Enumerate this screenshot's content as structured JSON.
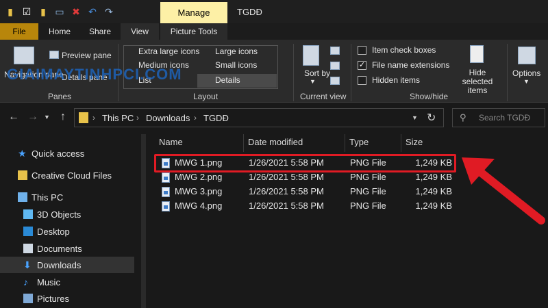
{
  "titlebar": {
    "manage_tab": "Manage",
    "window_title": "TGDĐ",
    "qat_icons": [
      "folder-icon",
      "checklist-icon",
      "folder-icon",
      "rename-icon",
      "delete-icon",
      "undo-icon",
      "redo-icon"
    ]
  },
  "tabs": {
    "file": "File",
    "home": "Home",
    "share": "Share",
    "view": "View",
    "picture_tools": "Picture Tools"
  },
  "ribbon": {
    "panes": {
      "navigation_pane": "Navigation pane",
      "preview_pane": "Preview pane",
      "details_pane": "Details pane",
      "label": "Panes"
    },
    "layout": {
      "extra_large": "Extra large icons",
      "large": "Large icons",
      "medium": "Medium icons",
      "small": "Small icons",
      "list": "List",
      "details": "Details",
      "label": "Layout"
    },
    "current_view": {
      "sort_by": "Sort by",
      "label": "Current view"
    },
    "show_hide": {
      "item_check_boxes": "Item check boxes",
      "file_name_extensions": "File name extensions",
      "hidden_items": "Hidden items",
      "hide_selected": "Hide selected items",
      "label": "Show/hide",
      "file_name_extensions_checked": true
    },
    "options": "Options"
  },
  "address": {
    "crumbs": [
      "This PC",
      "Downloads",
      "TGDĐ"
    ],
    "search_placeholder": "Search TGDĐ"
  },
  "sidebar": {
    "items": [
      {
        "label": "Quick access",
        "icon": "star-icon"
      },
      {
        "label": "Creative Cloud Files",
        "icon": "cloud-folder-icon"
      },
      {
        "label": "This PC",
        "icon": "computer-icon"
      },
      {
        "label": "3D Objects",
        "icon": "cube-icon"
      },
      {
        "label": "Desktop",
        "icon": "desktop-icon"
      },
      {
        "label": "Documents",
        "icon": "document-icon"
      },
      {
        "label": "Downloads",
        "icon": "download-icon"
      },
      {
        "label": "Music",
        "icon": "music-icon"
      },
      {
        "label": "Pictures",
        "icon": "pictures-icon"
      }
    ]
  },
  "files": {
    "columns": [
      "Name",
      "Date modified",
      "Type",
      "Size"
    ],
    "rows": [
      {
        "name": "MWG 1.png",
        "date": "1/26/2021 5:58 PM",
        "type": "PNG File",
        "size": "1,249 KB"
      },
      {
        "name": "MWG 2.png",
        "date": "1/26/2021 5:58 PM",
        "type": "PNG File",
        "size": "1,249 KB"
      },
      {
        "name": "MWG 3.png",
        "date": "1/26/2021 5:58 PM",
        "type": "PNG File",
        "size": "1,249 KB"
      },
      {
        "name": "MWG 4.png",
        "date": "1/26/2021 5:58 PM",
        "type": "PNG File",
        "size": "1,249 KB"
      }
    ]
  },
  "watermark": "GIAIMAYTINHPCI.COM",
  "colors": {
    "accent_file_tab": "#b8860b",
    "manage_tab": "#fdf0a6",
    "highlight": "#e01b24",
    "arrow": "#e01b24"
  }
}
